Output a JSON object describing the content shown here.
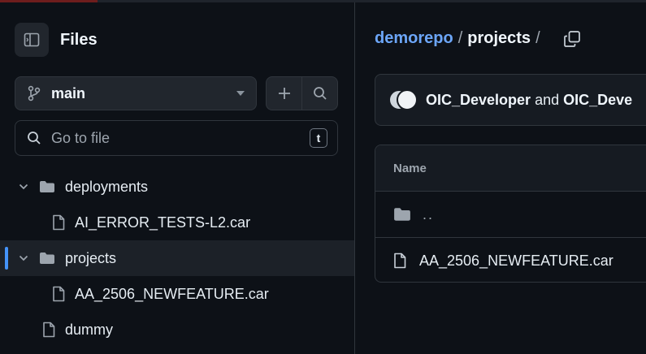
{
  "sidebar": {
    "title": "Files",
    "branch": "main",
    "search_placeholder": "Go to file",
    "search_shortcut": "t",
    "tree": [
      {
        "label": "deployments",
        "type": "folder",
        "expanded": true,
        "level": 0,
        "selected": false
      },
      {
        "label": "AI_ERROR_TESTS-L2.car",
        "type": "file",
        "level": 1,
        "selected": false
      },
      {
        "label": "projects",
        "type": "folder",
        "expanded": true,
        "level": 0,
        "selected": true
      },
      {
        "label": "AA_2506_NEWFEATURE.car",
        "type": "file",
        "level": 1,
        "selected": false
      },
      {
        "label": "dummy",
        "type": "file",
        "level": 0,
        "selected": false
      }
    ]
  },
  "main": {
    "breadcrumb": {
      "repo": "demorepo",
      "separator": "/",
      "dir": "projects",
      "trailing": "/"
    },
    "commit": {
      "author1": "OIC_Developer",
      "joiner": "and",
      "author2": "OIC_Deve"
    },
    "table": {
      "header": "Name",
      "parent_label": "..",
      "rows": [
        {
          "label": "AA_2506_NEWFEATURE.car",
          "type": "file"
        }
      ]
    }
  },
  "colors": {
    "background": "#0d1117",
    "accent_link": "#6ca6f8",
    "selection_bar": "#4493f8",
    "border": "#30363d"
  },
  "icons": {
    "sidebar_toggle": "sidebar-panel-icon",
    "branch": "git-branch-icon",
    "add": "plus-icon",
    "search": "search-icon",
    "folder": "folder-icon",
    "file": "file-icon",
    "expand": "chevron-down-icon",
    "copy": "copy-icon"
  }
}
